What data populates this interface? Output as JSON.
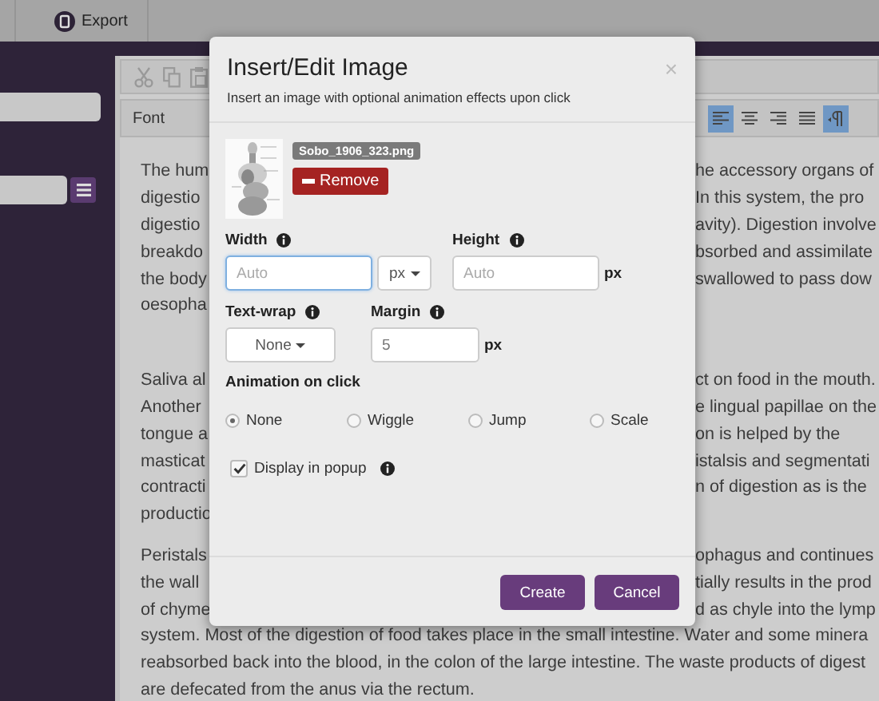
{
  "top_bar": {
    "export_label": "Export"
  },
  "toolbar": {
    "font_select": "Font",
    "edit_buttons": [
      {
        "kind": "cut"
      },
      {
        "kind": "copy"
      },
      {
        "kind": "paste"
      }
    ],
    "format_buttons": [
      {
        "kind": "align-left",
        "active": true
      },
      {
        "kind": "align-center",
        "active": false
      },
      {
        "kind": "align-right",
        "active": false
      },
      {
        "kind": "justify",
        "active": false
      },
      {
        "kind": "ltr",
        "active": true
      }
    ]
  },
  "editor": {
    "paragraphs": [
      {
        "lines": [
          {
            "left": "The hum",
            "right": "he accessory organs of"
          },
          {
            "left": "digestio",
            "right": "In this system, the pro"
          },
          {
            "left": "digestio",
            "right": "avity). Digestion involve"
          },
          {
            "left": "breakdo",
            "right": "bsorbed and assimilate"
          },
          {
            "left": "the body",
            "right": "swallowed to pass dow"
          },
          {
            "left": "oesopha"
          }
        ]
      },
      {
        "lines": [
          {
            "left": "Saliva al",
            "right": "ct on food in the mouth."
          },
          {
            "left": "Another",
            "right": "e lingual papillae on the"
          },
          {
            "left": "tongue a",
            "right": "on is helped by the"
          },
          {
            "left": "masticat",
            "right": "istalsis and segmentati"
          },
          {
            "left": "contracti",
            "right": "n of digestion as is the"
          },
          {
            "left": "productio"
          }
        ]
      },
      {
        "lines": [
          {
            "left": "Peristals",
            "right": "ophagus and continues"
          },
          {
            "left": "the wall",
            "right": "tially results in the prod"
          },
          {
            "left": "of chyme",
            "right": "d as chyle into the lymp"
          },
          {
            "text": "system. Most of the digestion of food takes place in the small intestine. Water and some minera"
          },
          {
            "text": "reabsorbed back into the blood, in the colon of the large intestine. The waste products of digest"
          },
          {
            "text": "are defecated from the anus via the rectum."
          }
        ]
      }
    ]
  },
  "dialog": {
    "title": "Insert/Edit Image",
    "subtitle": "Insert an image with optional animation effects upon click",
    "close": "×",
    "image": {
      "kind": "picture",
      "file_name": "Sobo_1906_323.png",
      "remove_label": "Remove"
    },
    "width": {
      "label": "Width",
      "placeholder": "Auto",
      "unit": "px",
      "focused": true
    },
    "height": {
      "label": "Height",
      "placeholder": "Auto",
      "unit": "px"
    },
    "text_wrap": {
      "label": "Text-wrap",
      "value": "None"
    },
    "margin": {
      "label": "Margin",
      "value": "5",
      "unit": "px"
    },
    "animation": {
      "label": "Animation on click",
      "options": [
        {
          "label": "None",
          "selected": true
        },
        {
          "label": "Wiggle",
          "selected": false
        },
        {
          "label": "Jump",
          "selected": false
        },
        {
          "label": "Scale",
          "selected": false
        }
      ]
    },
    "popup": {
      "label": "Display in popup",
      "checked": true
    },
    "buttons": [
      "Create",
      "Cancel"
    ]
  }
}
